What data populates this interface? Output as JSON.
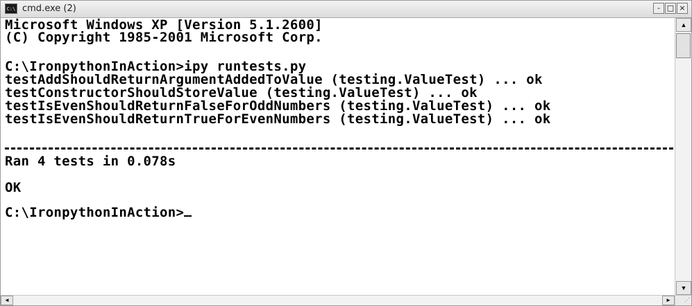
{
  "window": {
    "title": "cmd.exe (2)",
    "icon": "console-icon",
    "controls": {
      "minimize": "-",
      "maximize": "□",
      "close": "×"
    }
  },
  "console": {
    "lines": [
      "Microsoft Windows XP [Version 5.1.2600]",
      "(C) Copyright 1985-2001 Microsoft Corp.",
      "C:\\IronpythonInAction>ipy runtests.py",
      "testAddShouldReturnArgumentAddedToValue (testing.ValueTest) ... ok",
      "testConstructorShouldStoreValue (testing.ValueTest) ... ok",
      "testIsEvenShouldReturnFalseForOddNumbers (testing.ValueTest) ... ok",
      "testIsEvenShouldReturnTrueForEvenNumbers (testing.ValueTest) ... ok",
      "Ran 4 tests in 0.078s",
      "OK",
      "C:\\IronpythonInAction>"
    ]
  },
  "scrollbars": {
    "up": "▲",
    "down": "▼",
    "left": "◄",
    "right": "►"
  },
  "colors": {
    "background": "#ffffff",
    "text": "#000000"
  }
}
